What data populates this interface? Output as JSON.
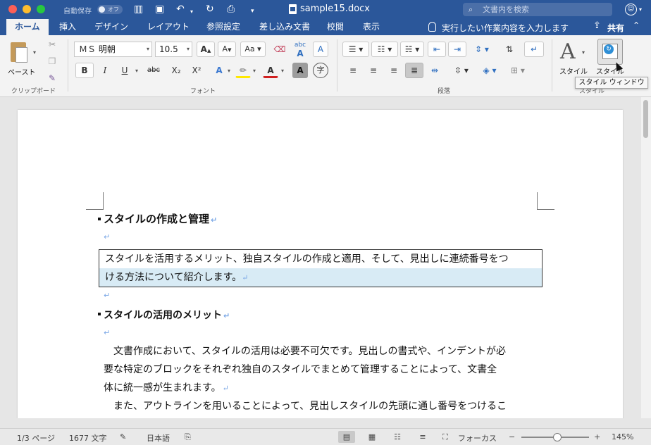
{
  "window": {
    "autosave_label": "自動保存",
    "autosave_state": "オフ",
    "title": "sample15.docx",
    "search_placeholder": "文書内を検索"
  },
  "tabs": [
    {
      "label": "ホーム",
      "active": true
    },
    {
      "label": "挿入"
    },
    {
      "label": "デザイン"
    },
    {
      "label": "レイアウト"
    },
    {
      "label": "参照設定"
    },
    {
      "label": "差し込み文書"
    },
    {
      "label": "校閲"
    },
    {
      "label": "表示"
    }
  ],
  "tellme": "実行したい作業内容を入力します",
  "share": "共有",
  "ribbon": {
    "clipboard": {
      "paste_label": "ペースト",
      "group_label": "クリップボード"
    },
    "font": {
      "font_name": "ＭＳ 明朝",
      "font_size": "10.5",
      "group_label": "フォント",
      "bold": "B",
      "italic": "I",
      "underline": "U",
      "strike": "abc",
      "subscript": "X₂",
      "superscript": "X²",
      "furigana": "abc",
      "char_border": "A",
      "enclose": "字",
      "grow": "A",
      "shrink": "A",
      "case": "Aa"
    },
    "paragraph": {
      "group_label": "段落"
    },
    "styles": {
      "styles_label": "スタイル",
      "pane_label": "スタイル",
      "group_label": "スタイル"
    },
    "tooltip": "スタイル ウィンドウ"
  },
  "document": {
    "heading1": "スタイルの作成と管理",
    "selected_line1": "スタイルを活用するメリット、独自スタイルの作成と適用、そして、見出しに連続番号をつ",
    "selected_line2": "ける方法について紹介します。",
    "heading2": "スタイルの活用のメリット",
    "body1_line1": "　文書作成において、スタイルの活用は必要不可欠です。見出しの書式や、インデントが必",
    "body1_line2": "要な特定のブロックをそれぞれ独自のスタイルでまとめて管理することによって、文書全",
    "body1_line3": "体に統一感が生まれます。",
    "body2_line1": "　また、アウトラインを用いることによって、見出しスタイルの先頭に通し番号をつけるこ",
    "pilcrow": "↵"
  },
  "status": {
    "page": "1/3 ページ",
    "words": "1677 文字",
    "language": "日本語",
    "focus": "フォーカス",
    "zoom": "145%",
    "zoom_minus": "−",
    "zoom_plus": "+"
  },
  "colors": {
    "brand": "#2b579a",
    "selection": "#d8ebf5",
    "pilcrow": "#7aa7e6"
  }
}
